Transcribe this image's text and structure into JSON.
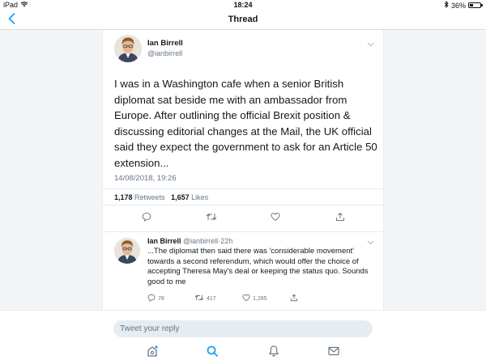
{
  "statusbar": {
    "device": "iPad",
    "time": "18:24",
    "battery_percent": "36%",
    "battery_level": 0.36
  },
  "nav": {
    "title": "Thread"
  },
  "main_tweet": {
    "author": "Ian Birrell",
    "handle": "@ianbirrell",
    "text": "I was in a Washington cafe when a senior British diplomat sat beside me with an ambassador from Europe. After outlining the official Brexit position & discussing editorial changes at the Mail, the UK official said they expect the government to ask for an Article 50 extension...",
    "timestamp": "14/08/2018, 19:26",
    "retweets_count": "1,178",
    "retweets_label": "Retweets",
    "likes_count": "1,657",
    "likes_label": "Likes"
  },
  "reply_tweet": {
    "author": "Ian Birrell",
    "handle": "@ianbirrell",
    "separator": "·",
    "age": "22h",
    "text": "...The diplomat then said there was 'considerable movement' towards a second referendum, which would offer the choice of accepting Theresa May's deal or keeping the status quo. Sounds good to me",
    "reply_count": "78",
    "retweet_count": "417",
    "like_count": "1,285"
  },
  "composer": {
    "placeholder": "Tweet your reply"
  },
  "icons": {
    "back": "chevron-left-icon",
    "caret": "chevron-down-icon",
    "reply": "reply-icon",
    "retweet": "retweet-icon",
    "like": "heart-icon",
    "share": "share-icon",
    "home": "home-icon",
    "search": "search-icon",
    "notifications": "bell-icon",
    "messages": "mail-icon"
  },
  "colors": {
    "accent": "#1da1f2",
    "text": "#14171a",
    "secondary": "#657786"
  }
}
